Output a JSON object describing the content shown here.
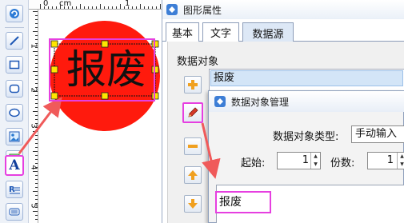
{
  "canvas": {
    "ruler_top_labels": [
      "0",
      "cm",
      "1"
    ],
    "ruler_left_labels": [
      "1",
      "2",
      "3",
      "4",
      "5"
    ],
    "stamp_text": "报废",
    "colors": {
      "stamp_fill": "#ff1a0d",
      "selection": "#ffe600",
      "highlight": "#e63fe0",
      "arrow": "#f05a5a"
    }
  },
  "toolbar": {
    "tools": [
      "refresh-icon",
      "line-icon",
      "rectangle-icon",
      "rounded-rect-icon",
      "ellipse-icon",
      "image-icon",
      "picture-icon",
      "text-icon",
      "rich-text-icon",
      "barcode-icon"
    ],
    "text_tool_letter": "A"
  },
  "dialog": {
    "title": "图形属性",
    "tabs": [
      "基本",
      "文字",
      "数据源"
    ],
    "active_tab": "数据源",
    "data_object_label": "数据对象",
    "data_object_item": "报废",
    "side_buttons": [
      "add-icon",
      "edit-icon",
      "remove-icon",
      "move-up-icon",
      "move-down-icon"
    ]
  },
  "dialog2": {
    "title": "数据对象管理",
    "type_label": "数据对象类型:",
    "type_value": "手动输入",
    "start_label": "起始:",
    "start_value": "1",
    "copies_label": "份数:",
    "copies_value": "1",
    "content_value": "报废"
  }
}
